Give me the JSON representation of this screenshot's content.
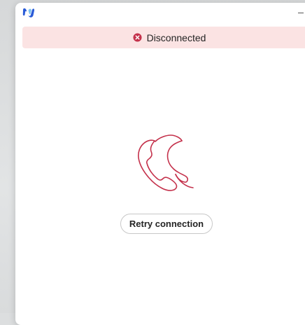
{
  "window": {
    "app_icon": "webex-logo-icon"
  },
  "banner": {
    "status_text": "Disconnected",
    "icon": "error-x-icon",
    "background": "#fbe3e3",
    "icon_color": "#c4314b"
  },
  "main": {
    "illustration": "disconnected-phone-icon",
    "illustration_color": "#c4314b",
    "retry_label": "Retry connection"
  }
}
